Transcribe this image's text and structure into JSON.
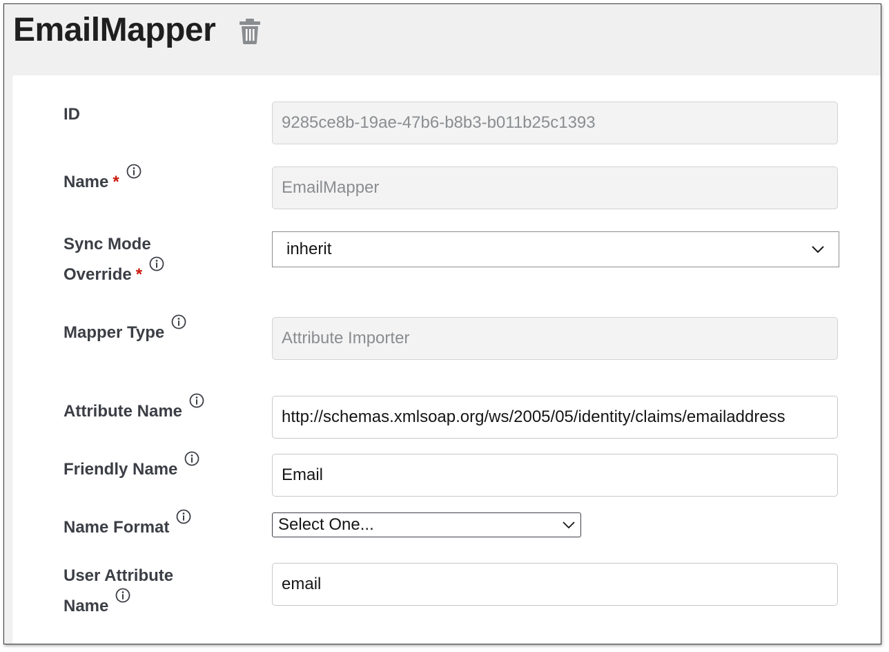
{
  "page": {
    "title": "EmailMapper"
  },
  "form": {
    "id": {
      "label": "ID",
      "value": "9285ce8b-19ae-47b6-b8b3-b011b25c1393"
    },
    "name": {
      "label": "Name",
      "required_mark": "*",
      "value": "EmailMapper"
    },
    "sync_mode": {
      "label_line1": "Sync Mode",
      "label_line2": "Override",
      "required_mark": "*",
      "value": "inherit"
    },
    "mapper_type": {
      "label": "Mapper Type",
      "value": "Attribute Importer"
    },
    "attribute_name": {
      "label": "Attribute Name",
      "value": "http://schemas.xmlsoap.org/ws/2005/05/identity/claims/emailaddress"
    },
    "friendly_name": {
      "label": "Friendly Name",
      "value": "Email"
    },
    "name_format": {
      "label": "Name Format",
      "value": "Select One..."
    },
    "user_attribute_name": {
      "label_line1": "User Attribute",
      "label_line2": "Name",
      "value": "email"
    }
  },
  "icons": {
    "delete": "trash-icon",
    "help": "info-circle-icon",
    "dropdown": "chevron-down-icon"
  },
  "colors": {
    "required": "#c9190b",
    "label": "#3b3e45",
    "readonly_bg": "#f3f3f3",
    "header_bg": "#f0f0f0"
  }
}
